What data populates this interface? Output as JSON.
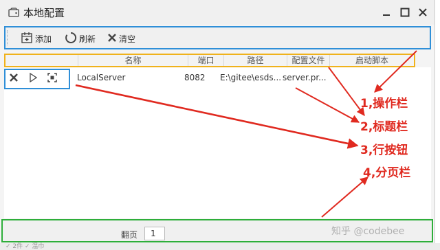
{
  "window": {
    "title": "本地配置",
    "minimize_label": "minimize",
    "maximize_label": "maximize",
    "close_label": "close"
  },
  "toolbar": {
    "add_label": "添加",
    "refresh_label": "刷新",
    "clear_label": "清空"
  },
  "table": {
    "columns": [
      "名称",
      "端口",
      "路径",
      "配置文件",
      "启动脚本"
    ],
    "rows": [
      {
        "name": "LocalServer",
        "port": "8082",
        "path": "E:\\gitee\\esds...",
        "config": "server.pr..."
      }
    ]
  },
  "pager": {
    "label": "翻页",
    "page": "1"
  },
  "annotations": [
    "1,操作栏",
    "2,标题栏",
    "3,行按钮",
    "4,分页栏"
  ],
  "annotation_color": "#e02a20",
  "watermark": "知乎 @codebee",
  "bottom_strip": "✓ 2件  ✓ 温巾"
}
